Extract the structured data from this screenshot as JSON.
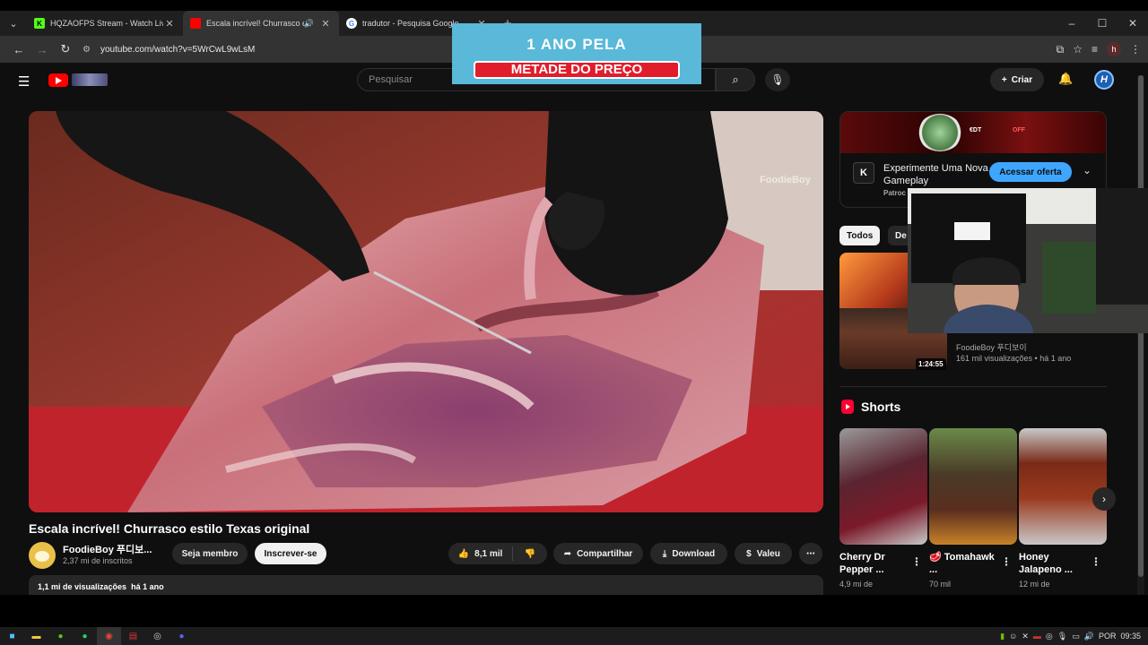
{
  "browser": {
    "tabs": [
      {
        "title": "HQZAOFPS Stream - Watch Live",
        "favicon": "kick-icon",
        "active": false
      },
      {
        "title": "Escala incrível! Churrasco estilo Texas original",
        "favicon": "youtube-icon",
        "active": true
      },
      {
        "title": "tradutor - Pesquisa Google",
        "favicon": "google-icon",
        "active": false
      }
    ],
    "url": "youtube.com/watch?v=5WrCwL9wLsM",
    "profile_initial": "h"
  },
  "youtube": {
    "search_placeholder": "Pesquisar",
    "create_label": "Criar",
    "account_initial": "H",
    "video": {
      "title": "Escala incrível! Churrasco estilo Texas original",
      "channel": "FoodieBoy 푸디보...",
      "subscribers": "2,37 mi de inscritos",
      "join_label": "Seja membro",
      "subscribe_label": "Inscrever-se",
      "likes": "8,1 mil",
      "share_label": "Compartilhar",
      "download_label": "Download",
      "thanks_label": "Valeu",
      "views": "1,1 mi de visualizações",
      "age": "há 1 ano",
      "watermark": "FoodieBoy"
    },
    "ad": {
      "logo_letter": "K",
      "title": "Experimente Uma Nova Gameplay",
      "sponsor": "Patroc",
      "cta": "Acessar oferta",
      "banner_tags": [
        "€DT",
        "OFF"
      ]
    },
    "chips": [
      "Todos",
      "De"
    ],
    "recommended": {
      "channel": "FoodieBoy 푸디보이",
      "meta": "161 mil visualizações • há 1 ano",
      "duration": "1:24:55"
    },
    "shorts_header": "Shorts",
    "shorts": [
      {
        "title": "Cherry Dr Pepper ...",
        "views": "4,9 mi de"
      },
      {
        "title": "🥩 Tomahawk ...",
        "views": "70 mil"
      },
      {
        "title": "Honey Jalapeno ...",
        "views": "12 mi de"
      }
    ]
  },
  "promo": {
    "line1": "1 ANO PELA",
    "line2": "METADE DO PREÇO"
  },
  "taskbar": {
    "language": "POR",
    "time": "09:35"
  },
  "colors": {
    "youtube_red": "#ff0000",
    "cta_blue": "#3ea6ff",
    "page_bg": "#0f0f0f"
  }
}
